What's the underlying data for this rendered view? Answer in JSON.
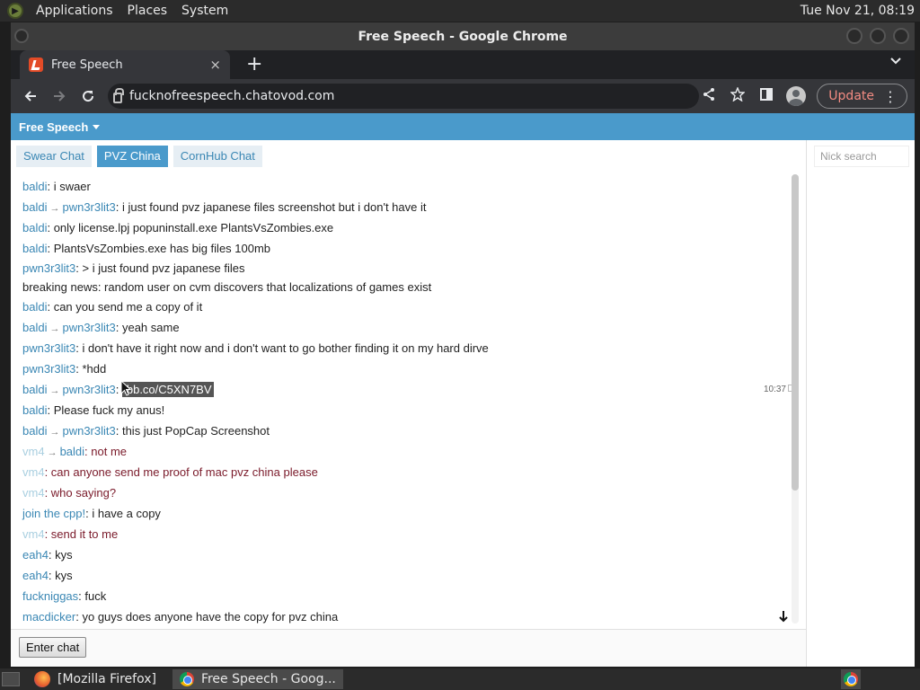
{
  "desktop": {
    "menus": [
      "Applications",
      "Places",
      "System"
    ],
    "clock": "Tue Nov 21, 08:19"
  },
  "window": {
    "title": "Free Speech - Google Chrome"
  },
  "browser": {
    "tab_title": "Free Speech",
    "tab_close": "×",
    "new_tab": "+",
    "tab_search": "⌄",
    "url": "fucknofreespeech.chatovod.com",
    "update_label": "Update"
  },
  "site": {
    "header_title": "Free Speech",
    "room_tabs": [
      "Swear Chat",
      "PVZ China",
      "CornHub Chat"
    ],
    "active_tab": "PVZ China",
    "messages": [
      {
        "from": "baldi",
        "to": "",
        "text": ": i swaer"
      },
      {
        "from": "baldi",
        "to": "pwn3r3lit3",
        "text": ": i just found pvz japanese files screenshot but i don't have it"
      },
      {
        "from": "baldi",
        "to": "",
        "text": ": only license.lpj popuninstall.exe PlantsVsZombies.exe"
      },
      {
        "from": "baldi",
        "to": "",
        "text": ": PlantsVsZombies.exe has big files 100mb"
      },
      {
        "from": "pwn3r3lit3",
        "to": "",
        "text": ": > i just found pvz japanese files"
      },
      {
        "from": "",
        "to": "",
        "text": "breaking news: random user on cvm discovers that localizations of games exist"
      },
      {
        "from": "baldi",
        "to": "",
        "text": ": can you send me a copy of it"
      },
      {
        "from": "baldi",
        "to": "pwn3r3lit3",
        "text": ": yeah same"
      },
      {
        "from": "pwn3r3lit3",
        "to": "",
        "text": ": i don't have it right now and i don't want to go bother finding it on my hard dirve"
      },
      {
        "from": "pwn3r3lit3",
        "to": "",
        "text": ": *hdd"
      },
      {
        "from": "baldi",
        "to": "pwn3r3lit3",
        "text": ": ",
        "selected": "ibb.co/C5XN7BV",
        "time": "10:37"
      },
      {
        "from": "baldi",
        "to": "",
        "text": ": Please fuck my anus!"
      },
      {
        "from": "baldi",
        "to": "pwn3r3lit3",
        "text": ": this just PopCap Screenshot"
      },
      {
        "from": "vm4",
        "to": "baldi",
        "text": ": not me",
        "faint": true,
        "red": true
      },
      {
        "from": "vm4",
        "to": "",
        "text": ": can anyone send me proof of mac pvz china please",
        "faint": true,
        "red": true
      },
      {
        "from": "vm4",
        "to": "",
        "text": ": who saying?",
        "faint": true,
        "red": true
      },
      {
        "from": "join the cpp!",
        "to": "",
        "text": ": i have a copy"
      },
      {
        "from": "vm4",
        "to": "",
        "text": ": send it to me",
        "faint": true,
        "red": true
      },
      {
        "from": "eah4",
        "to": "",
        "text": ": kys"
      },
      {
        "from": "eah4",
        "to": "",
        "text": ": kys"
      },
      {
        "from": "fuckniggas",
        "to": "",
        "text": ": fuck"
      },
      {
        "from": "macdicker",
        "to": "",
        "text": ": yo guys does anyone have the copy for pvz china"
      }
    ],
    "enter_chat_label": "Enter chat",
    "nick_search_placeholder": "Nick search"
  },
  "taskbar": {
    "tasks": [
      "[Mozilla Firefox]",
      "Free Speech - Goog..."
    ]
  }
}
